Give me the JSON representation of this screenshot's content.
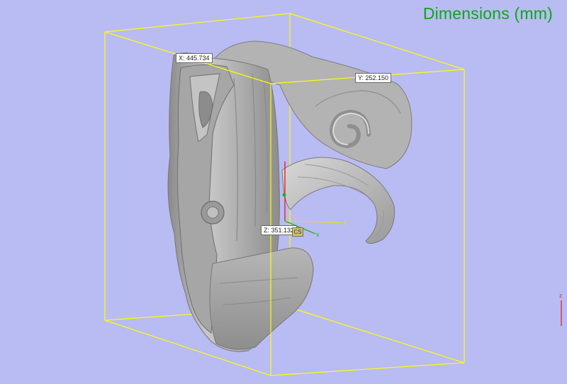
{
  "viewport": {
    "title": "Dimensions (mm)",
    "background": "#b9bbf3",
    "title_color": "#0aa816",
    "bbox_color": "#ffff00"
  },
  "dimensions": {
    "x_label": "X: 445.734",
    "y_label": "Y: 252.150",
    "z_label": "Z: 351.132"
  },
  "axes": {
    "cs_label": "CS",
    "x_axis_letter": "x",
    "y_axis_letter": "y",
    "z_axis_letter": "z"
  },
  "icons": {
    "model": "3d-mesh-ram-head-sculpture",
    "triad": "coordinate-axis-triad"
  }
}
